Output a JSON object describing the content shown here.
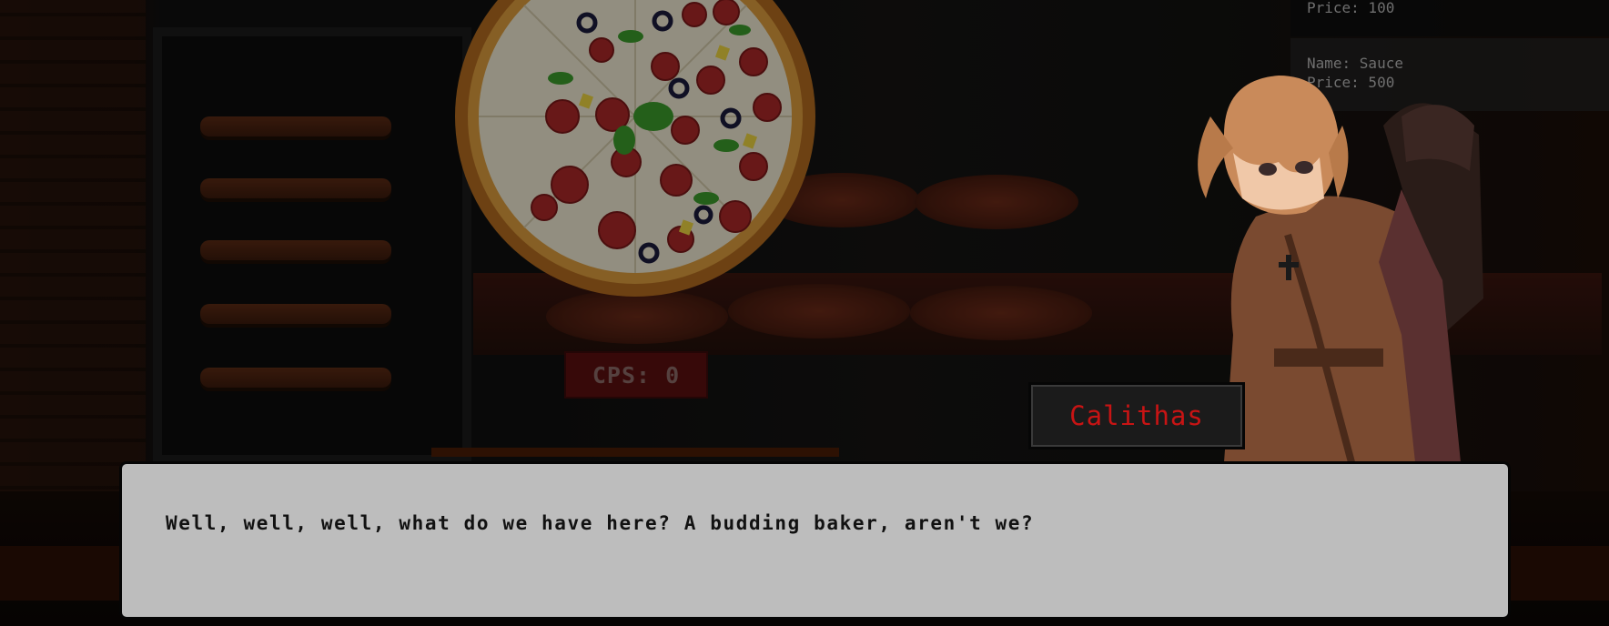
{
  "stats": {
    "cps_label": "CPS: 0"
  },
  "shop": {
    "items": [
      {
        "name_line": "",
        "price_line": "Price: 100"
      },
      {
        "name_line": "Name: Sauce",
        "price_line": "Price: 500"
      }
    ]
  },
  "dialogue": {
    "speaker": "Calithas",
    "text": "Well, well, well, what do we have here? A budding baker, aren't we?"
  },
  "colors": {
    "speaker_name": "#c81414",
    "dialog_bg": "#bdbdbd",
    "cps_bg": "#5a1010"
  },
  "icons": {
    "clicker": "pizza-icon"
  }
}
